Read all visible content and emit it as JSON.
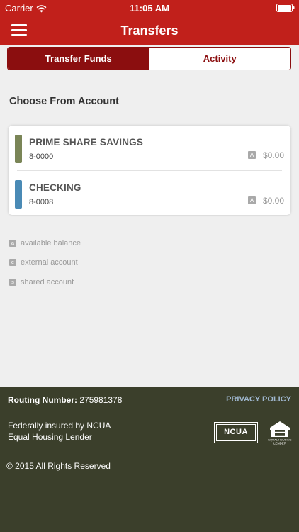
{
  "status_bar": {
    "carrier": "Carrier",
    "time": "11:05 AM",
    "wifi_icon": "wifi-icon",
    "battery_icon": "battery-icon"
  },
  "navbar": {
    "title": "Transfers",
    "menu_icon": "hamburger-menu-icon",
    "background_color": "#c1201b"
  },
  "tabs": [
    {
      "label": "Transfer Funds",
      "active": true
    },
    {
      "label": "Activity",
      "active": false
    }
  ],
  "accent_color": "#8b0e0f",
  "section_title": "Choose From Account",
  "accounts": [
    {
      "name": "PRIME SHARE SAVINGS",
      "number": "8-0000",
      "badge": "A",
      "balance": "$0.00",
      "color": "#7a8557"
    },
    {
      "name": "CHECKING",
      "number": "8-0008",
      "badge": "A",
      "balance": "$0.00",
      "color": "#4a8ab5"
    }
  ],
  "legend": [
    {
      "badge": "a",
      "label": "available balance"
    },
    {
      "badge": "e",
      "label": "external account"
    },
    {
      "badge": "s",
      "label": "shared account"
    }
  ],
  "footer": {
    "routing_label": "Routing Number:",
    "routing_number": "275981378",
    "privacy_link": "PRIVACY POLICY",
    "insured_line1": "Federally insured by NCUA",
    "insured_line2": "Equal Housing Lender",
    "ncua_logo_text": "NCUA",
    "ehl_logo_text": "EQUAL HOUSING LENDER",
    "copyright": "© 2015 All Rights Reserved",
    "background_color": "#3b3f2b"
  }
}
